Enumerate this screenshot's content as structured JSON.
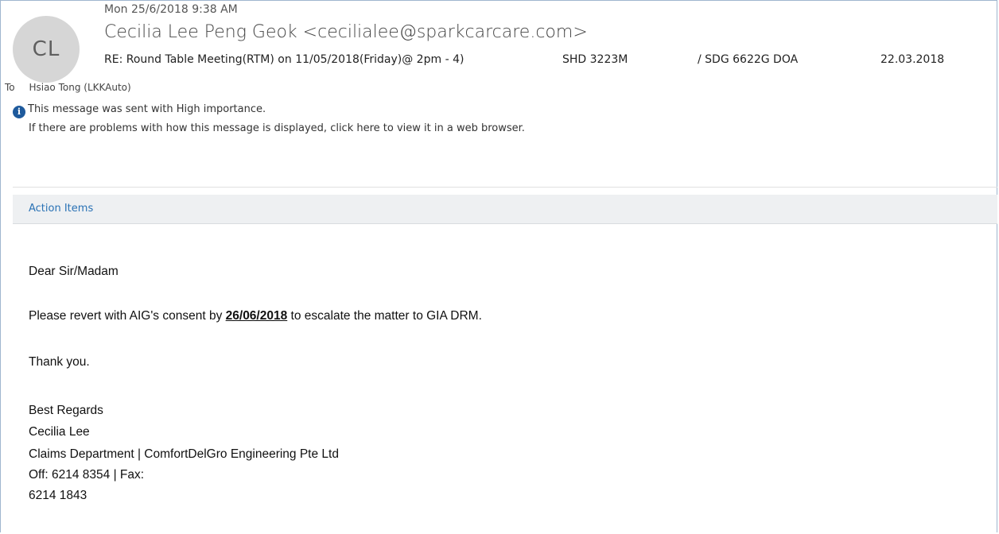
{
  "header": {
    "avatar_initials": "CL",
    "date": "Mon 25/6/2018 9:38 AM",
    "sender": "Cecilia Lee Peng Geok <cecilialee@sparkcarcare.com>",
    "subject": {
      "part1": "RE: Round Table Meeting(RTM) on 11/05/2018(Friday)@ 2pm - 4)",
      "part2": "SHD 3223M",
      "part3": "/ SDG 6622G DOA",
      "part4": "22.03.2018"
    },
    "to_label": "To",
    "to_value": "Hsiao Tong (LKKAuto)"
  },
  "info": {
    "icon": "info-icon",
    "importance": "This message was sent with High importance.",
    "browser_notice": "If there are problems with how this message is displayed, click here to view it in a web browser."
  },
  "action_items_label": "Action Items",
  "body": {
    "greeting": "Dear Sir/Madam",
    "line_prefix": "Please revert with AIG's consent by ",
    "deadline": "26/06/2018",
    "line_suffix": " to escalate the matter to GIA DRM.",
    "thanks": "Thank you.",
    "sign_off": "Best Regards",
    "name": "Cecilia Lee",
    "department": "Claims Department | ComfortDelGro Engineering Pte Ltd",
    "phone_line": "Off: 6214 8354 | Fax:",
    "fax_number": "6214 1843"
  },
  "colors": {
    "accent": "#2a72b5",
    "info_icon": "#1e5a9c",
    "action_bar": "#eef0f2"
  }
}
